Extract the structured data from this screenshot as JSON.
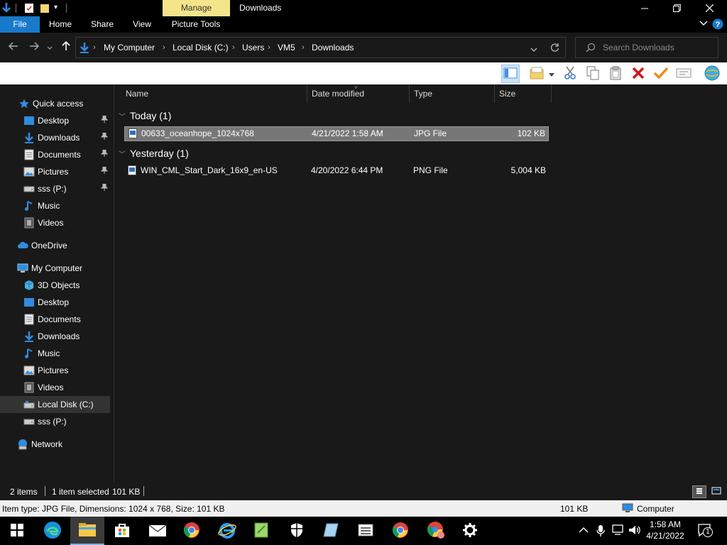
{
  "window": {
    "context_group": "Manage",
    "title": "Downloads",
    "minimize_icon": "minimize-icon",
    "maximize_icon": "restore-icon",
    "close_icon": "close-icon"
  },
  "ribbon": {
    "tabs": [
      {
        "label": "File"
      },
      {
        "label": "Home"
      },
      {
        "label": "Share"
      },
      {
        "label": "View"
      },
      {
        "label": "Picture Tools"
      }
    ]
  },
  "address": {
    "breadcrumbs": [
      "My Computer",
      "Local Disk (C:)",
      "Users",
      "VM5",
      "Downloads"
    ]
  },
  "search": {
    "placeholder": "Search Downloads"
  },
  "nav": {
    "quick_access": "Quick access",
    "quick_items": [
      {
        "label": "Desktop",
        "icon": "desktop-icon",
        "pinned": true
      },
      {
        "label": "Downloads",
        "icon": "downloads-icon",
        "pinned": true
      },
      {
        "label": "Documents",
        "icon": "documents-icon",
        "pinned": true
      },
      {
        "label": "Pictures",
        "icon": "pictures-icon",
        "pinned": true
      },
      {
        "label": "sss (P:)",
        "icon": "drive-icon",
        "pinned": true
      },
      {
        "label": "Music",
        "icon": "music-icon",
        "pinned": false
      },
      {
        "label": "Videos",
        "icon": "videos-icon",
        "pinned": false
      }
    ],
    "onedrive": "OneDrive",
    "my_computer": "My Computer",
    "computer_items": [
      {
        "label": "3D Objects",
        "icon": "3d-objects-icon"
      },
      {
        "label": "Desktop",
        "icon": "desktop-icon"
      },
      {
        "label": "Documents",
        "icon": "documents-icon"
      },
      {
        "label": "Downloads",
        "icon": "downloads-icon"
      },
      {
        "label": "Music",
        "icon": "music-icon"
      },
      {
        "label": "Pictures",
        "icon": "pictures-icon"
      },
      {
        "label": "Videos",
        "icon": "videos-icon"
      },
      {
        "label": "Local Disk (C:)",
        "icon": "local-disk-icon",
        "selected": true
      },
      {
        "label": "sss (P:)",
        "icon": "drive-icon"
      }
    ],
    "network": "Network"
  },
  "columns": {
    "name": "Name",
    "date": "Date modified",
    "type": "Type",
    "size": "Size"
  },
  "groups": [
    {
      "label": "Today (1)",
      "files": [
        {
          "name": "00633_oceanhope_1024x768",
          "date": "4/21/2022 1:58 AM",
          "type": "JPG File",
          "size": "102 KB",
          "selected": true
        }
      ]
    },
    {
      "label": "Yesterday (1)",
      "files": [
        {
          "name": "WIN_CML_Start_Dark_16x9_en-US",
          "date": "4/20/2022 6:44 PM",
          "type": "PNG File",
          "size": "5,004 KB",
          "selected": false
        }
      ]
    }
  ],
  "status": {
    "items": "2 items",
    "selected": "1 item selected",
    "selected_size": "101 KB"
  },
  "details": {
    "text": "Item type: JPG File, Dimensions: 1024 x 768, Size: 101 KB",
    "size": "101 KB",
    "location": "Computer"
  },
  "taskbar": {
    "time": "1:58 AM",
    "date": "4/21/2022",
    "notification_count": "1"
  },
  "colors": {
    "file_tab": "#1979ca",
    "context_group": "#f4e58a",
    "selection": "#777777"
  }
}
